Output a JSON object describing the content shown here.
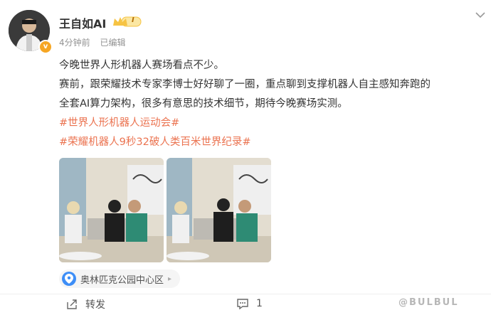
{
  "post": {
    "author": {
      "name": "王自如AI",
      "vip_level": "I",
      "avatar_badge": "v"
    },
    "meta": {
      "time": "4分钟前",
      "edited": "已编辑"
    },
    "content": {
      "line1": "今晚世界人形机器人赛场看点不少。",
      "line2": "赛前，跟荣耀技术专家李博士好好聊了一圈，重点聊到支撑机器人自主感知奔跑的",
      "line3": "全套AI算力架构，很多有意思的技术细节，期待今晚赛场实测。",
      "hashtags": [
        "#世界人形机器人运动会#",
        "#荣耀机器人9秒32破人类百米世界纪录#"
      ]
    },
    "location": "奥林匹克公园中心区",
    "actions": {
      "repost_label": "转发",
      "comment_count": "1"
    },
    "watermark": "@BULBUL"
  },
  "colors": {
    "hashtag": "#eb7350",
    "location_icon": "#3d8ef7",
    "vip_gold": "#f6c343"
  },
  "icons": [
    "more-chevron-icon",
    "location-pin-icon",
    "repost-icon",
    "comment-icon",
    "vip-crown-icon"
  ]
}
